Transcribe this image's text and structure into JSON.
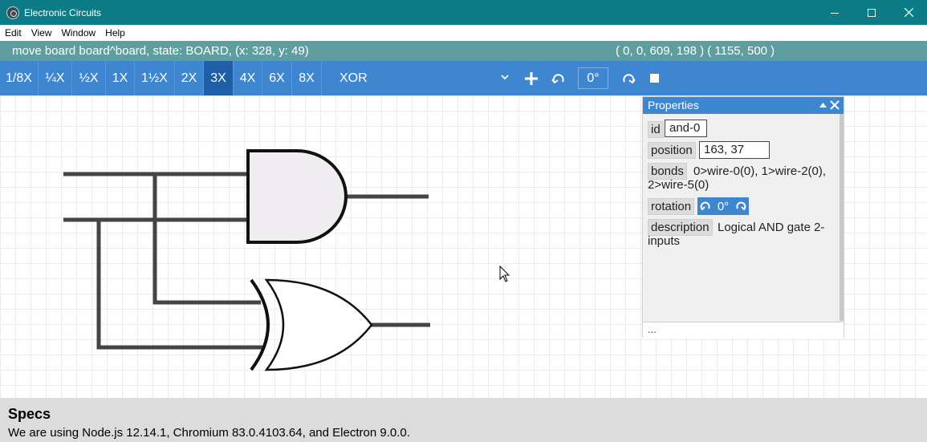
{
  "window": {
    "title": "Electronic Circuits",
    "icon": "app-logo-icon"
  },
  "menu": [
    "Edit",
    "View",
    "Window",
    "Help"
  ],
  "status": {
    "left": "move board board^board, state: BOARD, (x: 328, y: 49)",
    "right": "( 0, 0, 609, 198 )  ( 1155, 500 )"
  },
  "toolbar": {
    "zooms": [
      "1/8X",
      "¼X",
      "½X",
      "1X",
      "1½X",
      "2X",
      "3X",
      "4X",
      "6X",
      "8X"
    ],
    "active_zoom": "3X",
    "gate_select": "XOR",
    "rotation": "0°",
    "icons": [
      "chevron-down-icon",
      "plus-icon",
      "rotate-left-icon",
      "rotate-right-icon",
      "stop-icon"
    ]
  },
  "properties": {
    "title": "Properties",
    "id_label": "id",
    "id_value": "and-0",
    "position_label": "position",
    "position_value": "163, 37",
    "bonds_label": "bonds",
    "bonds_value": "0>wire-0(0), 1>wire-2(0), 2>wire-5(0)",
    "rotation_label": "rotation",
    "rotation_value": "0°",
    "description_label": "description",
    "description_value": "Logical AND gate 2-inputs",
    "footer": "..."
  },
  "specs": {
    "title": "Specs",
    "text": "We are using Node.js 12.14.1, Chromium 83.0.4103.64, and Electron 9.0.0."
  },
  "colors": {
    "titlebar": "#0e7c86",
    "statusbar": "#5f9ea0",
    "toolbar": "#3f86d1",
    "toolbar_active": "#1f5fa8"
  }
}
